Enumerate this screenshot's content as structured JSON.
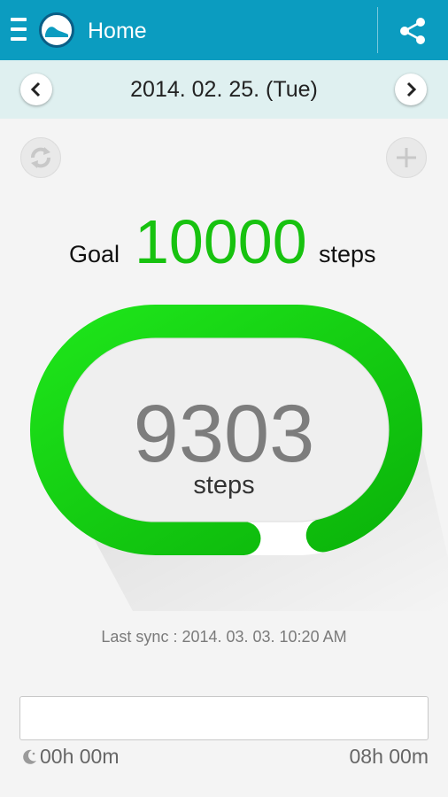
{
  "appbar": {
    "title": "Home"
  },
  "datebar": {
    "date": "2014. 02. 25. (Tue)"
  },
  "goal": {
    "label": "Goal",
    "value": "10000",
    "unit": "steps"
  },
  "count": {
    "value": "9303",
    "unit": "steps",
    "progress": 0.9303
  },
  "sync": {
    "text": "Last sync : 2014. 03. 03. 10:20 AM"
  },
  "timeline": {
    "start": "00h 00m",
    "end": "08h 00m"
  },
  "colors": {
    "appbar": "#0b9cc0",
    "datebar": "#dff0f0",
    "accent_green": "#17c20f",
    "ring_remaining": "#ffffff",
    "background": "#f4f4f4"
  },
  "icons": {
    "menu": "menu-icon",
    "logo": "shoe-logo-icon",
    "share": "share-icon",
    "prev": "chevron-left-icon",
    "next": "chevron-right-icon",
    "refresh": "refresh-icon",
    "add": "plus-icon",
    "moon": "moon-icon"
  }
}
